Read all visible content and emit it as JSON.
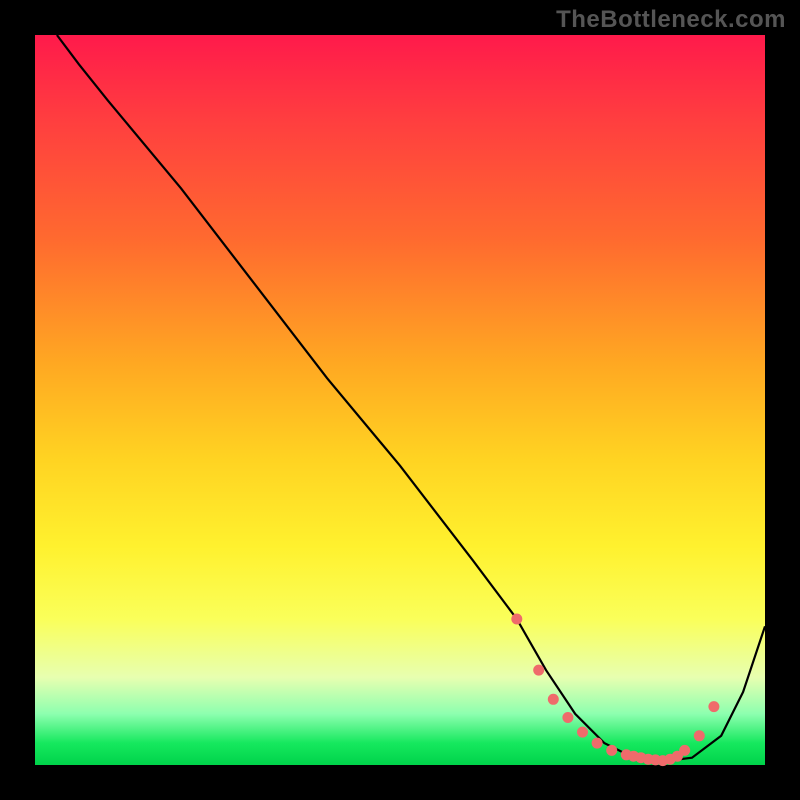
{
  "watermark": "TheBottleneck.com",
  "chart_data": {
    "type": "line",
    "title": "",
    "xlabel": "",
    "ylabel": "",
    "xlim": [
      0,
      100
    ],
    "ylim": [
      0,
      100
    ],
    "grid": false,
    "legend": false,
    "background": "gradient-red-to-green-vertical",
    "series": [
      {
        "name": "bottleneck-curve",
        "color": "#000000",
        "x": [
          3,
          6,
          10,
          20,
          30,
          40,
          50,
          60,
          66,
          70,
          74,
          78,
          82,
          86,
          90,
          94,
          97,
          100
        ],
        "y": [
          100,
          96,
          91,
          79,
          66,
          53,
          41,
          28,
          20,
          13,
          7,
          3,
          1,
          0.5,
          1,
          4,
          10,
          19
        ]
      }
    ],
    "markers": {
      "name": "flat-region-dots",
      "color": "#ef6b6b",
      "x": [
        66,
        69,
        71,
        73,
        75,
        77,
        79,
        81,
        82,
        83,
        84,
        85,
        86,
        87,
        88,
        89,
        91,
        93
      ],
      "y": [
        20,
        13,
        9,
        6.5,
        4.5,
        3,
        2,
        1.4,
        1.2,
        1.0,
        0.8,
        0.7,
        0.6,
        0.8,
        1.2,
        2.0,
        4.0,
        8.0
      ]
    }
  }
}
